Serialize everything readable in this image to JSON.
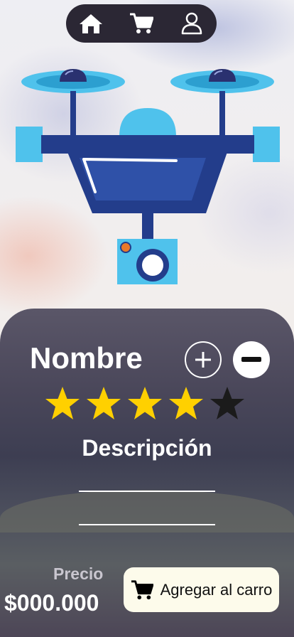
{
  "nav": {
    "items": [
      {
        "icon": "home-icon"
      },
      {
        "icon": "cart-icon"
      },
      {
        "icon": "user-icon"
      }
    ]
  },
  "product": {
    "image": "drone-illustration",
    "name": "Nombre",
    "rating": 4,
    "rating_max": 5,
    "description_label": "Descripción",
    "price_label": "Precio",
    "price": "$000.000",
    "add_to_cart_label": "Agregar al carro"
  },
  "colors": {
    "nav_bg": "#2b2734",
    "star_filled": "#ffd000",
    "star_empty": "#1b1b1b",
    "button_bg": "#fdfbeb"
  }
}
